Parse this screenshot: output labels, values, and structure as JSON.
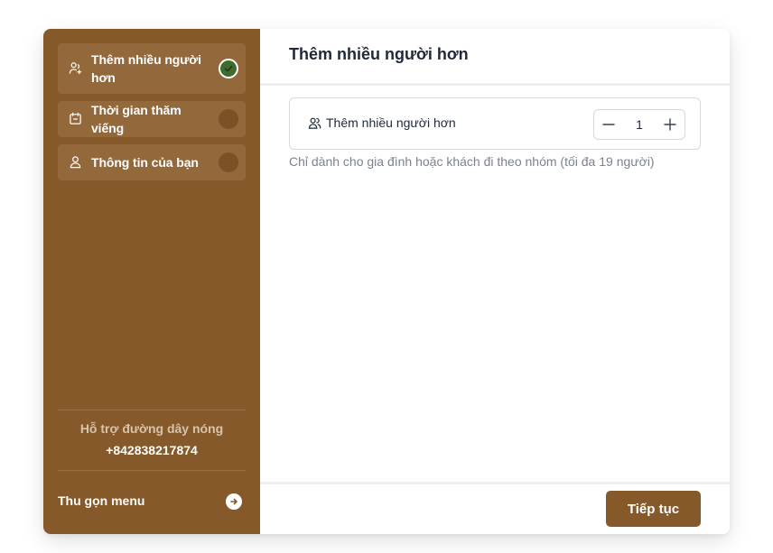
{
  "sidebar": {
    "steps": [
      {
        "label": "Thêm nhiều người hơn",
        "icon": "user-plus-icon",
        "status": "completed"
      },
      {
        "label": "Thời gian thăm viếng",
        "icon": "calendar-icon",
        "status": "pending"
      },
      {
        "label": "Thông tin của bạn",
        "icon": "user-icon",
        "status": "pending"
      }
    ],
    "hotline": {
      "label": "Hỗ trợ đường dây nóng",
      "phone": "+842838217874"
    },
    "collapse_label": "Thu gọn menu"
  },
  "main": {
    "title": "Thêm nhiều người hơn",
    "guest_row": {
      "label": "Thêm nhiều người hơn",
      "quantity": "1"
    },
    "hint": "Chỉ dành cho gia đình hoặc khách đi theo nhóm (tối đa 19 người)",
    "continue_label": "Tiếp tục"
  },
  "colors": {
    "brand": "#855929",
    "step_bg": "#93683a",
    "success": "#3f6b2f"
  }
}
